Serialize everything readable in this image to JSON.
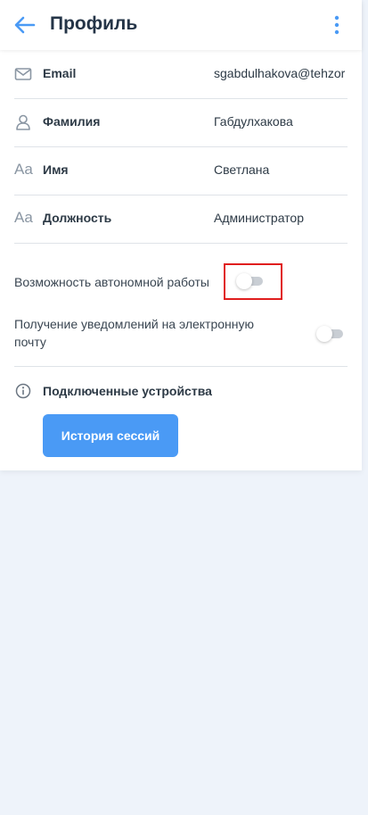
{
  "header": {
    "title": "Профиль",
    "back_icon": "arrow-left-icon",
    "menu_icon": "more-vertical-icon"
  },
  "fields": [
    {
      "icon": "mail-icon",
      "label": "Email",
      "value": "sgabdulhakova@tehzor"
    },
    {
      "icon": "user-icon",
      "label": "Фамилия",
      "value": "Габдулхакова"
    },
    {
      "icon": "text-aa-icon",
      "icon_text": "Aa",
      "label": "Имя",
      "value": "Светлана"
    },
    {
      "icon": "text-aa-icon",
      "icon_text": "Aa",
      "label": "Должность",
      "value": "Администратор"
    }
  ],
  "toggles": [
    {
      "label": "Возможность автономной работы",
      "checked": false
    },
    {
      "label": "Получение уведомлений на электронную почту",
      "checked": false
    }
  ],
  "devices": {
    "icon": "info-icon",
    "label": "Подключенные устройства",
    "button_label": "История сессий"
  },
  "colors": {
    "accent": "#4a9af5",
    "background": "#eef3fa",
    "highlight": "#e01e1e"
  }
}
